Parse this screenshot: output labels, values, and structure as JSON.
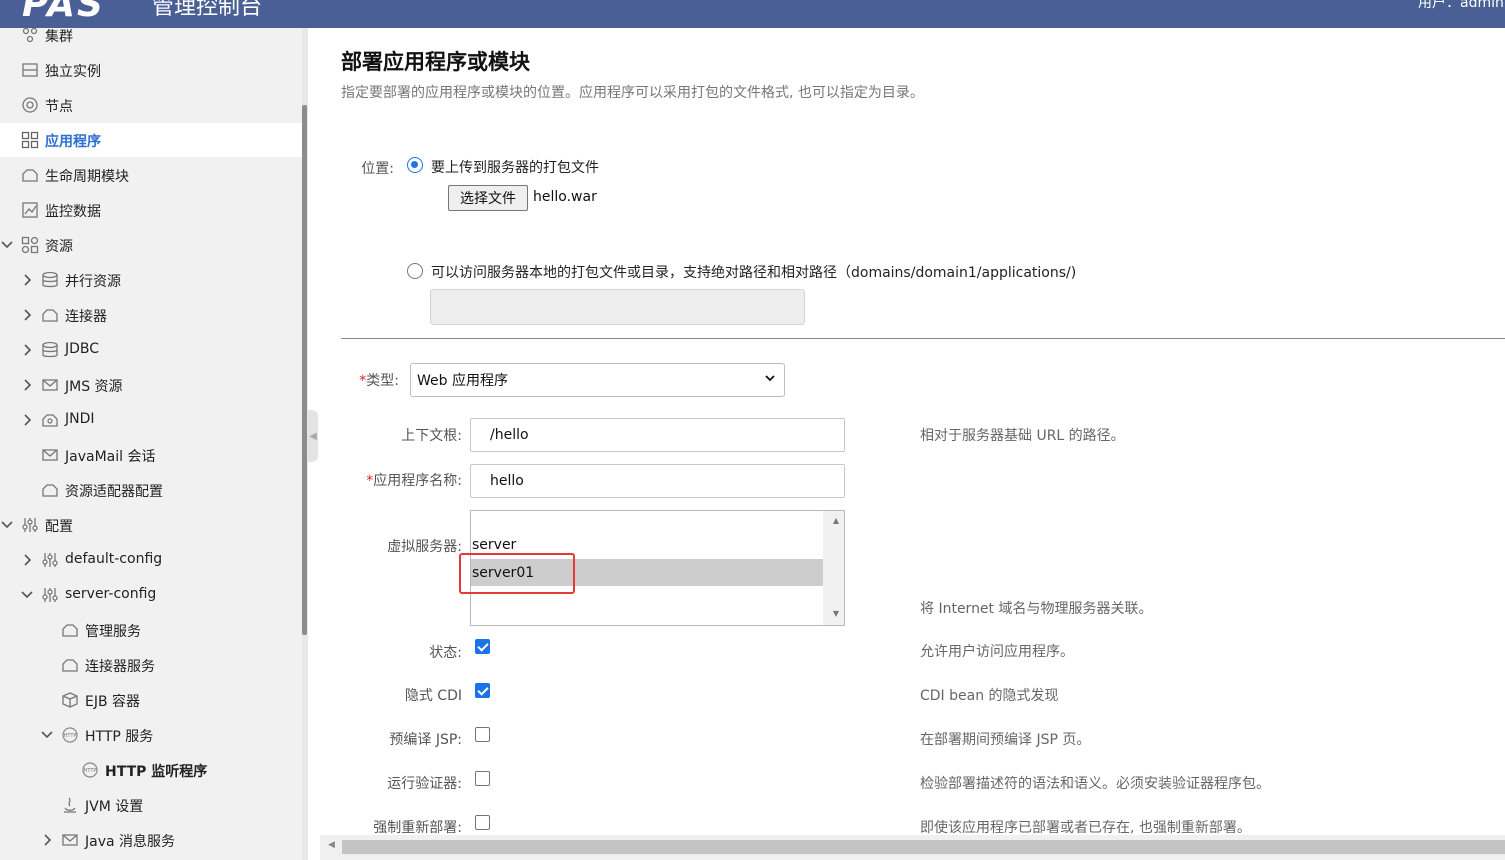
{
  "header": {
    "logo": "PAS",
    "title": "管理控制台",
    "user": "用户：admin"
  },
  "sidebar": {
    "items": [
      {
        "label": "集群",
        "icon": "cluster-icon",
        "chevron": "none"
      },
      {
        "label": "独立实例",
        "icon": "instance-icon",
        "chevron": "none"
      },
      {
        "label": "节点",
        "icon": "node-icon",
        "chevron": "none"
      },
      {
        "label": "应用程序",
        "icon": "applications-icon",
        "chevron": "none",
        "selected": true
      },
      {
        "label": "生命周期模块",
        "icon": "lifecycle-icon",
        "chevron": "none"
      },
      {
        "label": "监控数据",
        "icon": "monitoring-icon",
        "chevron": "none"
      },
      {
        "label": "资源",
        "icon": "resources-icon",
        "chevron": "down"
      },
      {
        "label": "并行资源",
        "icon": "database-icon",
        "chevron": "right"
      },
      {
        "label": "连接器",
        "icon": "connector-icon",
        "chevron": "right"
      },
      {
        "label": "JDBC",
        "icon": "database-icon",
        "chevron": "right"
      },
      {
        "label": "JMS 资源",
        "icon": "jms-icon",
        "chevron": "right"
      },
      {
        "label": "JNDI",
        "icon": "jndi-icon",
        "chevron": "right"
      },
      {
        "label": "JavaMail 会话",
        "icon": "mail-icon",
        "chevron": "none"
      },
      {
        "label": "资源适配器配置",
        "icon": "adapter-icon",
        "chevron": "none"
      },
      {
        "label": "配置",
        "icon": "config-icon",
        "chevron": "down"
      },
      {
        "label": "default-config",
        "icon": "config-icon",
        "chevron": "right"
      },
      {
        "label": "server-config",
        "icon": "config-icon",
        "chevron": "down"
      },
      {
        "label": "管理服务",
        "icon": "service-icon",
        "chevron": "none"
      },
      {
        "label": "连接器服务",
        "icon": "service-icon",
        "chevron": "none"
      },
      {
        "label": "EJB 容器",
        "icon": "ejb-icon",
        "chevron": "none"
      },
      {
        "label": "HTTP 服务",
        "icon": "http-icon",
        "chevron": "down"
      },
      {
        "label": "HTTP 监听程序",
        "icon": "http-icon",
        "chevron": "none",
        "bold": true
      },
      {
        "label": "JVM 设置",
        "icon": "java-icon",
        "chevron": "none"
      },
      {
        "label": "Java 消息服务",
        "icon": "jms-icon",
        "chevron": "right"
      }
    ]
  },
  "main": {
    "title": "部署应用程序或模块",
    "description": "指定要部署的应用程序或模块的位置。应用程序可以采用打包的文件格式, 也可以指定为目录。",
    "location_label": "位置:",
    "upload_option": "要上传到服务器的打包文件",
    "choose_file_button": "选择文件",
    "file_name": "hello.war",
    "local_option": "可以访问服务器本地的打包文件或目录，支持绝对路径和相对路径（domains/domain1/applications/)",
    "local_path_value": "",
    "type_label": "类型:",
    "type_value": "Web 应用程序",
    "context_root_label": "上下文根:",
    "context_root_value": "/hello",
    "context_root_help": "相对于服务器基础 URL 的路径。",
    "app_name_label": "应用程序名称:",
    "app_name_value": "hello",
    "virtual_servers_label": "虚拟服务器:",
    "virtual_servers": [
      "server",
      "server01"
    ],
    "virtual_servers_selected": "server01",
    "virtual_servers_help": "将 Internet 域名与物理服务器关联。",
    "status_label": "状态:",
    "status_checked": true,
    "status_help": "允许用户访问应用程序。",
    "cdi_label": "隐式 CDI",
    "cdi_checked": true,
    "cdi_help": "CDI bean 的隐式发现",
    "precompile_label": "预编译 JSP:",
    "precompile_checked": false,
    "precompile_help": "在部署期间预编译 JSP 页。",
    "verifier_label": "运行验证器:",
    "verifier_checked": false,
    "verifier_help": "检验部署描述符的语法和语义。必须安装验证器程序包。",
    "force_label": "强制重新部署:",
    "force_checked": false,
    "force_help": "即使该应用程序已部署或者已存在, 也强制重新部署。",
    "required_mark": "*"
  },
  "colors": {
    "header": "#4a5f95",
    "accent": "#2c6fd2",
    "highlight": "#e53935"
  }
}
